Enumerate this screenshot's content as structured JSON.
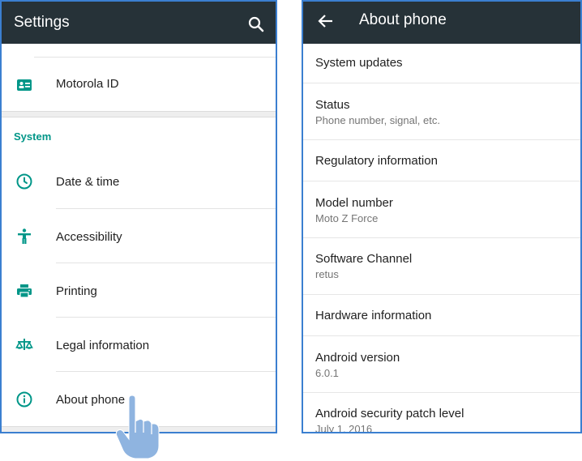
{
  "left": {
    "title": "Settings",
    "items_top": [
      {
        "label": "Motorola ID",
        "icon": "account-card-icon"
      }
    ],
    "section_header": "System",
    "items": [
      {
        "label": "Date & time",
        "icon": "clock-icon"
      },
      {
        "label": "Accessibility",
        "icon": "accessibility-icon"
      },
      {
        "label": "Printing",
        "icon": "printer-icon"
      },
      {
        "label": "Legal information",
        "icon": "scale-icon"
      },
      {
        "label": "About phone",
        "icon": "info-icon"
      }
    ]
  },
  "right": {
    "title": "About phone",
    "items": [
      {
        "title": "System updates",
        "subtitle": ""
      },
      {
        "title": "Status",
        "subtitle": "Phone number, signal, etc."
      },
      {
        "title": "Regulatory information",
        "subtitle": ""
      },
      {
        "title": "Model number",
        "subtitle": "Moto Z Force"
      },
      {
        "title": "Software Channel",
        "subtitle": "retus"
      },
      {
        "title": "Hardware information",
        "subtitle": ""
      },
      {
        "title": "Android version",
        "subtitle": "6.0.1"
      },
      {
        "title": "Android security patch level",
        "subtitle": "July 1, 2016"
      }
    ]
  },
  "colors": {
    "appbar": "#263238",
    "accent": "#009688",
    "frame": "#3b7fd0",
    "hand": "#8fb4e0"
  },
  "icons": {
    "search": "search-icon",
    "back": "back-arrow-icon",
    "pointer": "pointing-hand-icon"
  }
}
